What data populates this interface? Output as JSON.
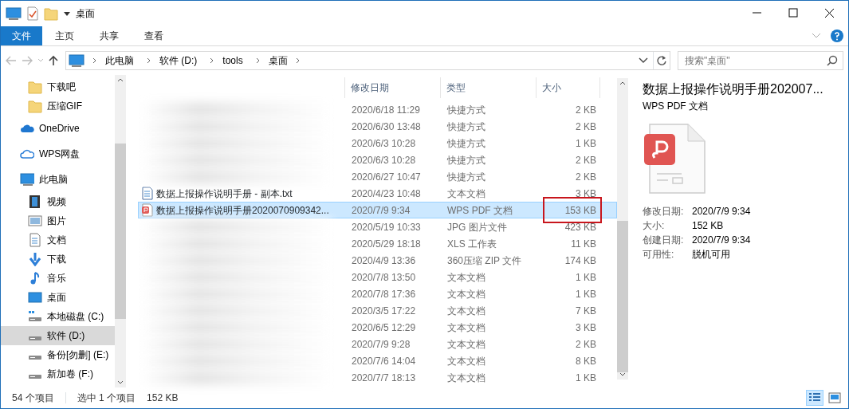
{
  "window": {
    "title": "桌面"
  },
  "ribbon_tabs": [
    {
      "label": "文件",
      "selected": true
    },
    {
      "label": "主页",
      "selected": false
    },
    {
      "label": "共享",
      "selected": false
    },
    {
      "label": "查看",
      "selected": false
    }
  ],
  "breadcrumb": [
    "此电脑",
    "软件 (D:)",
    "tools",
    "桌面"
  ],
  "search": {
    "placeholder": "搜索\"桌面\""
  },
  "sidebar": {
    "items": [
      {
        "label": "下载吧",
        "kind": "folder",
        "selected": false
      },
      {
        "label": "压缩GIF",
        "kind": "folder",
        "selected": false
      },
      {
        "label": "OneDrive",
        "kind": "cloud",
        "selected": false
      },
      {
        "label": "WPS网盘",
        "kind": "wps",
        "selected": false
      },
      {
        "label": "此电脑",
        "kind": "pc",
        "selected": false,
        "children": [
          {
            "label": "视频",
            "kind": "video",
            "selected": false
          },
          {
            "label": "图片",
            "kind": "picture",
            "selected": false
          },
          {
            "label": "文档",
            "kind": "document",
            "selected": false
          },
          {
            "label": "下载",
            "kind": "download",
            "selected": false
          },
          {
            "label": "音乐",
            "kind": "music",
            "selected": false
          },
          {
            "label": "桌面",
            "kind": "desktop",
            "selected": false
          },
          {
            "label": "本地磁盘 (C:)",
            "kind": "system-drive",
            "selected": false
          },
          {
            "label": "软件 (D:)",
            "kind": "drive",
            "selected": true
          },
          {
            "label": "备份[勿删] (E:)",
            "kind": "drive",
            "selected": false
          },
          {
            "label": "新加卷 (F:)",
            "kind": "drive",
            "selected": false
          }
        ]
      }
    ]
  },
  "table": {
    "columns": [
      "修改日期",
      "类型",
      "大小"
    ],
    "rows": [
      {
        "date": "2020/6/18 11:29",
        "type": "快捷方式",
        "size": "2 KB",
        "selected": false
      },
      {
        "date": "2020/6/30 13:48",
        "type": "快捷方式",
        "size": "2 KB",
        "selected": false
      },
      {
        "date": "2020/6/3 10:28",
        "type": "快捷方式",
        "size": "1 KB",
        "selected": false
      },
      {
        "date": "2020/6/3 10:28",
        "type": "快捷方式",
        "size": "2 KB",
        "selected": false
      },
      {
        "date": "2020/6/27 10:47",
        "type": "快捷方式",
        "size": "2 KB",
        "selected": false
      },
      {
        "name": "数据上报操作说明手册 - 副本.txt",
        "kind": "text",
        "date": "2020/4/23 10:48",
        "type": "文本文档",
        "size": "3 KB",
        "selected": false
      },
      {
        "name": "数据上报操作说明手册2020070909342...",
        "kind": "pdf",
        "date": "2020/7/9 9:34",
        "type": "WPS PDF 文档",
        "size": "153 KB",
        "selected": true,
        "highlighted": true
      },
      {
        "date": "2020/5/19 10:33",
        "type": "JPG 图片文件",
        "size": "423 KB",
        "selected": false
      },
      {
        "date": "2020/5/29 18:18",
        "type": "XLS 工作表",
        "size": "11 KB",
        "selected": false
      },
      {
        "date": "2020/4/9 13:36",
        "type": "360压缩 ZIP 文件",
        "size": "174 KB",
        "selected": false
      },
      {
        "date": "2020/7/8 13:50",
        "type": "文本文档",
        "size": "1 KB",
        "selected": false
      },
      {
        "date": "2020/7/8 17:36",
        "type": "文本文档",
        "size": "1 KB",
        "selected": false
      },
      {
        "date": "2020/3/5 17:22",
        "type": "文本文档",
        "size": "7 KB",
        "selected": false
      },
      {
        "date": "2020/6/5 12:29",
        "type": "文本文档",
        "size": "3 KB",
        "selected": false
      },
      {
        "date": "2020/7/9 9:28",
        "type": "文本文档",
        "size": "2 KB",
        "selected": false
      },
      {
        "date": "2020/7/6 14:04",
        "type": "文本文档",
        "size": "8 KB",
        "selected": false
      },
      {
        "date": "2020/7/7 18:13",
        "type": "文本文档",
        "size": "1 KB",
        "selected": false
      }
    ]
  },
  "preview": {
    "title": "数据上报操作说明手册202007...",
    "type": "WPS PDF 文档",
    "properties": [
      {
        "label": "修改日期:",
        "value": "2020/7/9 9:34"
      },
      {
        "label": "大小:",
        "value": "152 KB"
      },
      {
        "label": "创建日期:",
        "value": "2020/7/9 9:34"
      },
      {
        "label": "可用性:",
        "value": "脱机可用"
      }
    ]
  },
  "status_bar": {
    "count": "54 个项目",
    "selection": "选中 1 个项目",
    "size": "152 KB"
  },
  "view_buttons": [
    {
      "kind": "details",
      "selected": true
    },
    {
      "kind": "large-icons",
      "selected": false
    }
  ]
}
